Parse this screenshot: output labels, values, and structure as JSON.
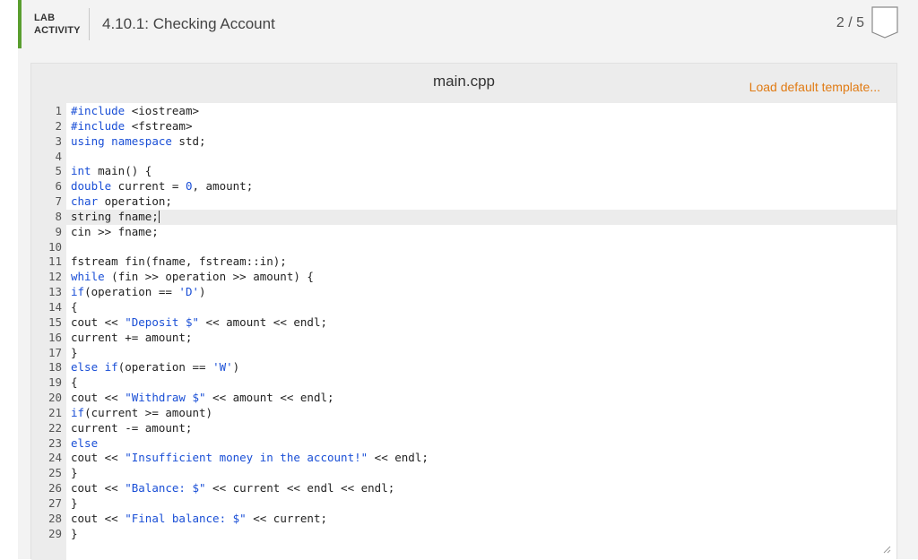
{
  "header": {
    "lab_line1": "LAB",
    "lab_line2": "ACTIVITY",
    "title": "4.10.1: Checking Account",
    "progress": "2 / 5",
    "accent_color": "#5a9e2f"
  },
  "editor": {
    "file_name": "main.cpp",
    "load_template_label": "Load default template...",
    "link_color": "#e07b14",
    "active_line": 8,
    "lines": [
      "#include <iostream>",
      "#include <fstream>",
      "using namespace std;",
      "",
      "int main() {",
      "double current = 0, amount;",
      "char operation;",
      "string fname;",
      "cin >> fname;",
      "",
      "fstream fin(fname, fstream::in);",
      "while (fin >> operation >> amount) {",
      "if(operation == 'D')",
      "{",
      "cout << \"Deposit $\" << amount << endl;",
      "current += amount;",
      "}",
      "else if(operation == 'W')",
      "{",
      "cout << \"Withdraw $\" << amount << endl;",
      "if(current >= amount)",
      "current -= amount;",
      "else",
      "cout << \"Insufficient money in the account!\" << endl;",
      "}",
      "cout << \"Balance: $\" << current << endl << endl;",
      "}",
      "cout << \"Final balance: $\" << current;",
      "}"
    ]
  }
}
